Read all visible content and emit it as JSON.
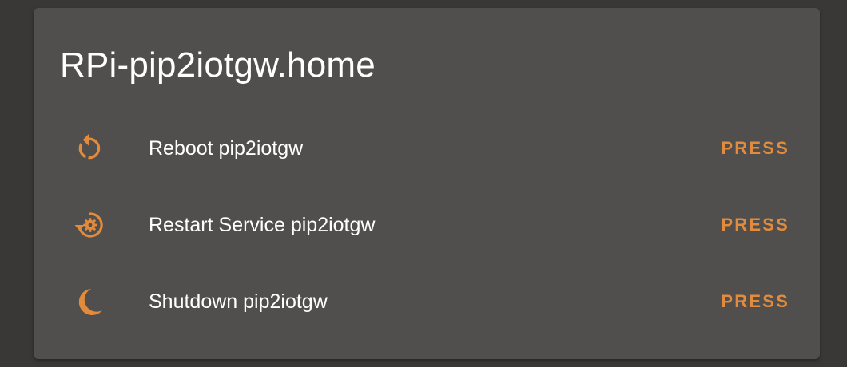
{
  "card": {
    "title": "RPi-pip2iotgw.home"
  },
  "entities": [
    {
      "icon": "restart-icon",
      "label": "Reboot pip2iotgw",
      "action": "PRESS"
    },
    {
      "icon": "restart-service-gear-icon",
      "label": "Restart Service pip2iotgw",
      "action": "PRESS"
    },
    {
      "icon": "moon-icon",
      "label": "Shutdown pip2iotgw",
      "action": "PRESS"
    }
  ],
  "colors": {
    "background": "#393837",
    "card": "#504f4d",
    "accent": "#e38b3c",
    "text": "#ffffff"
  }
}
